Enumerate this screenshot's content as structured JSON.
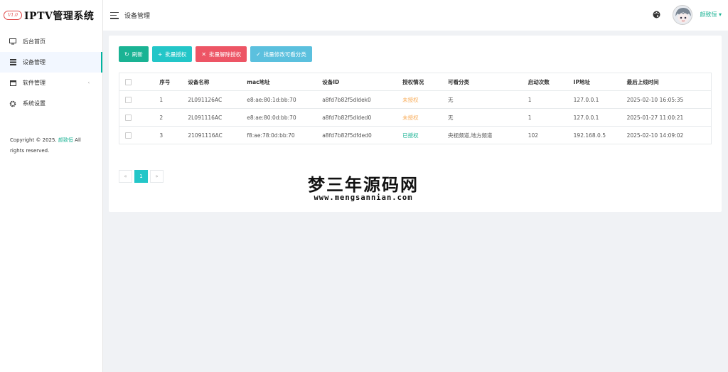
{
  "app": {
    "logo_badge": "V1.0",
    "title": "IPTV管理系统"
  },
  "sidebar": {
    "items": [
      {
        "label": "后台首页",
        "icon": "monitor-icon",
        "active": false
      },
      {
        "label": "设备管理",
        "icon": "list-icon",
        "active": true
      },
      {
        "label": "软件管理",
        "icon": "window-icon",
        "active": false,
        "expandable": true
      },
      {
        "label": "系统设置",
        "icon": "gear-icon",
        "active": false
      }
    ],
    "copyright_prefix": "Copyright © 2025.",
    "copyright_author": "颜致恒",
    "copyright_suffix": "All rights reserved."
  },
  "header": {
    "breadcrumb": "设备管理",
    "username": "颜致恒",
    "dropdown_glyph": "▾"
  },
  "toolbar": {
    "refresh": "刷新",
    "batch_auth": "批量授权",
    "batch_revoke": "批量解除授权",
    "batch_category": "批量修改可看分类"
  },
  "table": {
    "headers": [
      "序号",
      "设备名称",
      "mac地址",
      "设备ID",
      "授权情况",
      "可看分类",
      "启动次数",
      "IP地址",
      "最后上线时间"
    ],
    "rows": [
      [
        "1",
        "2L091126AC",
        "e8:ae:80:1d:bb:70",
        "a8fd7b82f5dldek0",
        "未授权",
        "无",
        "1",
        "127.0.0.1",
        "2025-02-10 16:05:35"
      ],
      [
        "2",
        "2L091116AC",
        "e8:ae:80:0d:bb:70",
        "a8fd7b82f5dlded0",
        "未授权",
        "无",
        "1",
        "127.0.0.1",
        "2025-01-27 11:00:21"
      ],
      [
        "3",
        "21091116AC",
        "f8:ae:78:0d:bb:70",
        "a8fd7b82f5dfded0",
        "已授权",
        "央视频道,地方频道",
        "102",
        "192.168.0.5",
        "2025-02-10 14:09:02"
      ]
    ]
  },
  "pagination": {
    "prev": "«",
    "current": "1",
    "next": "»"
  },
  "watermark": {
    "cn": "梦三年源码网",
    "en": "www.mengsannian.com"
  },
  "colors": {
    "accent": "#1ab394",
    "teal": "#23c6c8",
    "red": "#ed5565",
    "cyan": "#5bc0de",
    "warning": "#f8ac59"
  }
}
